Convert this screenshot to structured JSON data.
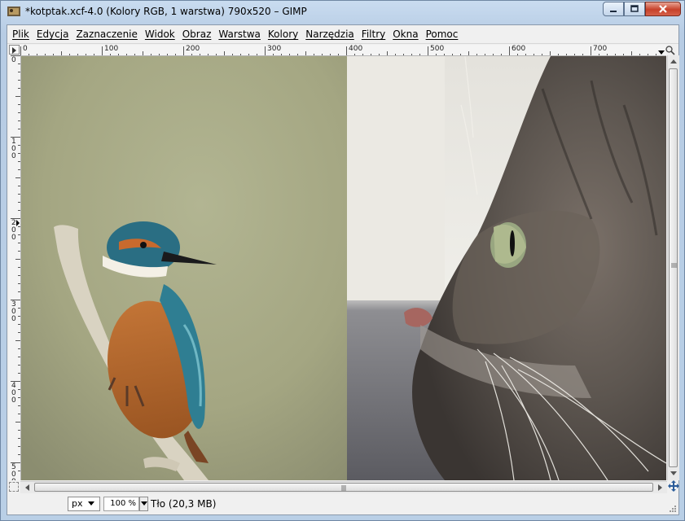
{
  "window": {
    "title": "*kotptak.xcf-4.0 (Kolory RGB, 1 warstwa) 790x520 – GIMP"
  },
  "menu": {
    "items": [
      "Plik",
      "Edycja",
      "Zaznaczenie",
      "Widok",
      "Obraz",
      "Warstwa",
      "Kolory",
      "Narzędzia",
      "Filtry",
      "Okna",
      "Pomoc"
    ]
  },
  "rulers": {
    "horizontal_labels": [
      "0",
      "100",
      "200",
      "300",
      "400",
      "500",
      "600",
      "700"
    ],
    "vertical_labels": [
      "0",
      "100",
      "200",
      "300",
      "400",
      "500"
    ]
  },
  "status": {
    "unit": "px",
    "zoom": "100 %",
    "layer_info": "Tło (20,3 MB)"
  },
  "canvas": {
    "description_left": "kingfisher-photo",
    "description_right": "cat-photo"
  }
}
